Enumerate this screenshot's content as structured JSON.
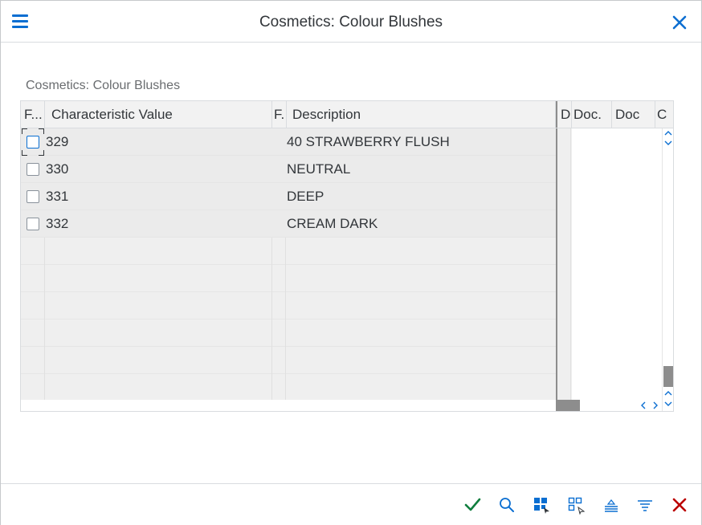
{
  "dialog": {
    "title": "Cosmetics: Colour Blushes"
  },
  "section": {
    "title": "Cosmetics: Colour Blushes"
  },
  "table": {
    "columns": [
      "F...",
      "Characteristic Value",
      "F.",
      "Description",
      "D",
      "Doc.",
      "Doc",
      "C"
    ],
    "rows": [
      {
        "value": "329",
        "description": "40 STRAWBERRY FLUSH"
      },
      {
        "value": "330",
        "description": "NEUTRAL"
      },
      {
        "value": "331",
        "description": "DEEP"
      },
      {
        "value": "332",
        "description": "CREAM DARK"
      }
    ]
  },
  "colors": {
    "accent": "#0a6ed1",
    "confirm": "#107e3e",
    "cancel": "#bb0000"
  },
  "footer": {
    "icons": [
      "checkmark-icon",
      "search-icon",
      "select-all-icon",
      "deselect-all-icon",
      "sort-ascending-icon",
      "filter-icon",
      "cancel-icon"
    ]
  }
}
